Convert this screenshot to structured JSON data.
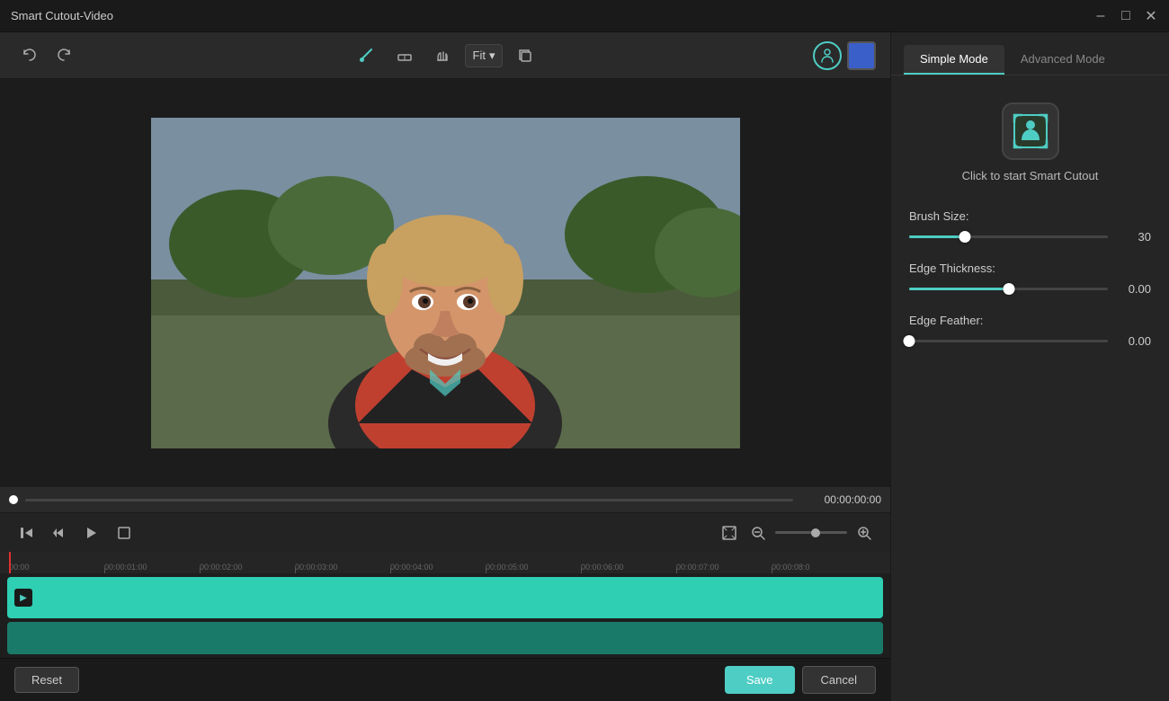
{
  "titleBar": {
    "title": "Smart Cutout-Video",
    "controls": [
      "minimize",
      "maximize",
      "close"
    ]
  },
  "toolbar": {
    "undo_label": "↩",
    "redo_label": "↪",
    "brush_label": "✏",
    "eraser_label": "⌫",
    "hand_label": "✋",
    "fit_label": "Fit",
    "fit_arrow": "▾",
    "copy_label": "⧉",
    "person_label": "👤",
    "color_label": ""
  },
  "video": {
    "timestamp": "00:00:00:00"
  },
  "timeline": {
    "marks": [
      "00:00",
      "00:00:01:00",
      "00:00:02:00",
      "00:00:03:00",
      "00:00:04:00",
      "00:00:05:00",
      "00:00:06:00",
      "00:00:07:00",
      "00:00:08:0"
    ]
  },
  "playback": {
    "skip_back": "⏮",
    "step_back": "⏪",
    "play": "▶",
    "stop": "■",
    "expand": "⤢",
    "zoom_out": "⊖",
    "zoom_in": "⊕"
  },
  "rightPanel": {
    "simpleModeLabel": "Simple Mode",
    "advancedModeLabel": "Advanced Mode",
    "cutoutLabel": "Click to start Smart Cutout",
    "brushSize": {
      "label": "Brush Size:",
      "value": "30",
      "percent": 28
    },
    "edgeThickness": {
      "label": "Edge Thickness:",
      "value": "0.00",
      "percent": 50
    },
    "edgeFeather": {
      "label": "Edge Feather:",
      "value": "0.00",
      "percent": 0
    }
  },
  "bottomBar": {
    "resetLabel": "Reset",
    "saveLabel": "Save",
    "cancelLabel": "Cancel"
  }
}
